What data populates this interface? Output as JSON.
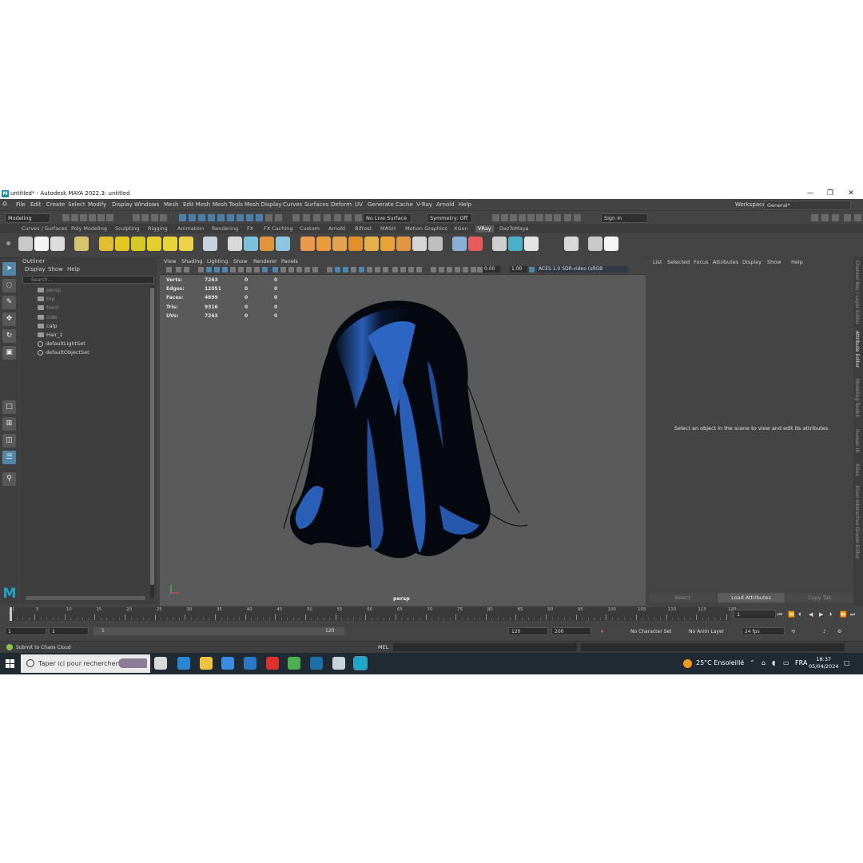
{
  "window": {
    "title": "untitled* - Autodesk MAYA 2022.3: untitled",
    "logo_letter": "M",
    "controls": [
      "—",
      "❐",
      "✕"
    ]
  },
  "menubar": {
    "items": [
      "File",
      "Edit",
      "Create",
      "Select",
      "Modify",
      "Display",
      "Windows",
      "Mesh",
      "Edit Mesh",
      "Mesh Tools",
      "Mesh Display",
      "Curves",
      "Surfaces",
      "Deform",
      "UV",
      "Generate",
      "Cache",
      "V-Ray",
      "Arnold",
      "Help"
    ],
    "workspace_label": "Workspace:",
    "workspace_value": "General*"
  },
  "statusline": {
    "mode": "Modeling",
    "live_surface": "No Live Surface",
    "symmetry": "Symmetry: Off",
    "sign_in": "Sign In"
  },
  "shelf": {
    "tabs": [
      "Curves / Surfaces",
      "Poly Modeling",
      "Sculpting",
      "Rigging",
      "Animation",
      "Rendering",
      "FX",
      "FX Caching",
      "Custom",
      "Arnold",
      "Bifrost",
      "MASH",
      "Motion Graphics",
      "XGen",
      "VRay",
      "DazToMaya"
    ],
    "active_tab": "VRay",
    "icon_colors": [
      "#c9c9c9",
      "#f5f5f5",
      "#dcdcdc",
      "#d8c46a",
      "#e0c030",
      "#e2c820",
      "#d7c828",
      "#e4cf2d",
      "#e6d43a",
      "#eed34a",
      "#c8d4e2",
      "#d8d8d8",
      "#7cc1df",
      "#e2943c",
      "#8ec5e0",
      "#e99a4a",
      "#ea9b3a",
      "#e3a24d",
      "#e28f2c",
      "#e6b04a",
      "#e8a238",
      "#e39642",
      "#d5d5d5",
      "#bfbfbf",
      "#8ab0d8",
      "#e75b5b",
      "#cfcfcf",
      "#4bb0c8",
      "#e4e4e4",
      "#d8d8d8"
    ]
  },
  "outliner": {
    "title": "Outliner",
    "menu": [
      "Display",
      "Show",
      "Help"
    ],
    "search_placeholder": "Search...",
    "items": [
      {
        "label": "persp",
        "dim": true,
        "kind": "cam"
      },
      {
        "label": "top",
        "dim": true,
        "kind": "cam"
      },
      {
        "label": "front",
        "dim": true,
        "kind": "cam"
      },
      {
        "label": "side",
        "dim": true,
        "kind": "cam"
      },
      {
        "label": "calp",
        "dim": false,
        "kind": "mesh"
      },
      {
        "label": "Hair_1",
        "dim": false,
        "kind": "mesh"
      },
      {
        "label": "defaultLightSet",
        "dim": false,
        "kind": "set"
      },
      {
        "label": "defaultObjectSet",
        "dim": false,
        "kind": "set"
      }
    ]
  },
  "viewport": {
    "menu": [
      "View",
      "Shading",
      "Lighting",
      "Show",
      "Renderer",
      "Panels"
    ],
    "exposure": "0.00",
    "gamma": "1.00",
    "color_space": "ACES 1.0 SDR-video (sRGB",
    "camera_label": "persp",
    "hud": [
      {
        "label": "Verts:",
        "v1": "7263",
        "v2": "0",
        "v3": "0"
      },
      {
        "label": "Edges:",
        "v1": "12051",
        "v2": "0",
        "v3": "0"
      },
      {
        "label": "Faces:",
        "v1": "4899",
        "v2": "0",
        "v3": "0"
      },
      {
        "label": "Tris:",
        "v1": "9316",
        "v2": "0",
        "v3": "0"
      },
      {
        "label": "UVs:",
        "v1": "7263",
        "v2": "0",
        "v3": "0"
      }
    ],
    "hair_color": "#2a5fb8"
  },
  "attribute_editor": {
    "menu": [
      "List",
      "Selected",
      "Focus",
      "Attributes",
      "Display",
      "Show",
      "Help"
    ],
    "empty_message": "Select an object in the scene to view and edit its attributes",
    "buttons": [
      "Select",
      "Load Attributes",
      "Copy Tab"
    ]
  },
  "side_tabs": [
    "Channel Box / Layer Editor",
    "Attribute Editor",
    "Modeling Toolkit",
    "Human IK",
    "XGen",
    "XGen Interactive Groom Editor"
  ],
  "timeline": {
    "ticks": [
      "1",
      "5",
      "10",
      "15",
      "20",
      "25",
      "30",
      "35",
      "40",
      "45",
      "50",
      "55",
      "60",
      "65",
      "70",
      "75",
      "80",
      "85",
      "90",
      "95",
      "100",
      "105",
      "110",
      "115",
      "120"
    ],
    "current_frame": "1"
  },
  "range": {
    "start": "1",
    "inner_start": "1",
    "slider_start": "1",
    "slider_end": "120",
    "inner_end": "120",
    "end": "200",
    "character_set": "No Character Set",
    "anim_layer": "No Anim Layer",
    "fps": "24 fps"
  },
  "command_line": {
    "status": "Submit to Chaos Cloud",
    "lang": "MEL"
  },
  "taskbar": {
    "search_placeholder": "Taper ici pour rechercher",
    "weather": "25°C  Ensoleillé",
    "language": "FRA",
    "time": "18:37",
    "date": "05/04/2024",
    "app_colors": [
      "#d9d9d9",
      "#2b86d6",
      "#f0c040",
      "#3a8de0",
      "#2c78c8",
      "#e0302c",
      "#4caf50",
      "#1b6ea8",
      "#c8d4dc",
      "#1ba9c9"
    ]
  }
}
